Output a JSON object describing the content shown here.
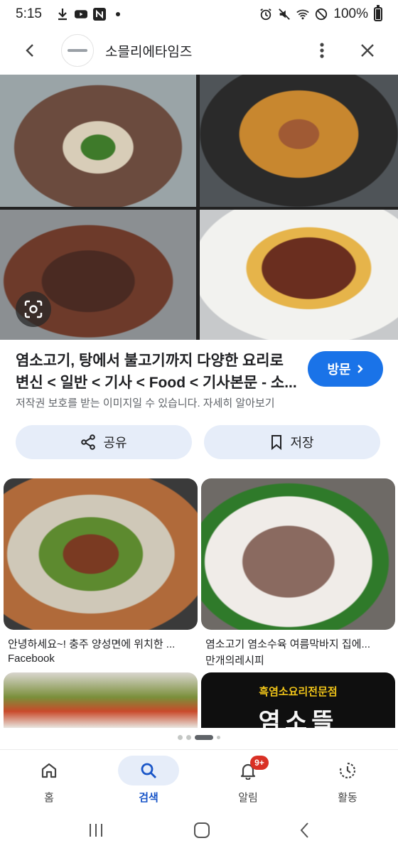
{
  "status_bar": {
    "time": "5:15",
    "battery": "100%"
  },
  "top_bar": {
    "site_name": "소믈리에타임즈"
  },
  "result": {
    "title": "염소고기, 탕에서 불고기까지 다양한 요리로 변신 < 일반 < 기사 < Food < 기사본문 - 소...",
    "visit_label": "방문",
    "copyright_note": "저작권 보호를 받는 이미지일 수 있습니다. 자세히 알아보기",
    "share_label": "공유",
    "save_label": "저장"
  },
  "related": [
    {
      "caption": "안녕하세요~! 충주 양성면에 위치한 ...",
      "source": "Facebook"
    },
    {
      "caption": "염소고기 염소수육 여름막바지 집에...",
      "source": "만개의레시피"
    },
    {
      "caption": "",
      "source": ""
    },
    {
      "overlay_line1": "흑염소요리전문점",
      "overlay_line2": "염소뜰"
    }
  ],
  "pager": {
    "total": 4,
    "active": 2
  },
  "bottom_nav": {
    "items": [
      {
        "label": "홈",
        "icon": "home-icon"
      },
      {
        "label": "검색",
        "icon": "search-icon"
      },
      {
        "label": "알림",
        "icon": "bell-icon",
        "badge": "9+"
      },
      {
        "label": "활동",
        "icon": "activity-icon"
      }
    ],
    "active_index": 1
  },
  "colors": {
    "accent": "#1a73e8",
    "pill_bg": "#e6edf9",
    "badge": "#d93025"
  }
}
